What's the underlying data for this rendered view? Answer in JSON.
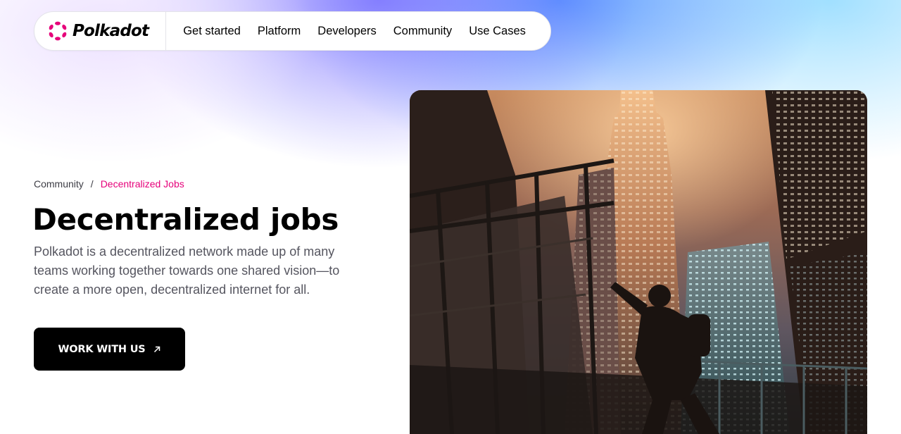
{
  "brand": {
    "name": "Polkadot",
    "accent_color": "#e6007a",
    "logo_icon": "polkadot-logo-icon"
  },
  "nav": {
    "items": [
      {
        "label": "Get started"
      },
      {
        "label": "Platform"
      },
      {
        "label": "Developers"
      },
      {
        "label": "Community"
      },
      {
        "label": "Use Cases"
      }
    ]
  },
  "breadcrumb": {
    "parent": "Community",
    "separator": "/",
    "current": "Decentralized Jobs"
  },
  "hero": {
    "title": "Decentralized jobs",
    "description": "Polkadot is a decentralized network made up of many teams working together towards one shared vision—to create a more open, decentralized internet for all.",
    "cta_label": "WORK WITH US",
    "cta_icon": "arrow-up-right-icon",
    "image_icon": "city-skyscraper-photo"
  }
}
